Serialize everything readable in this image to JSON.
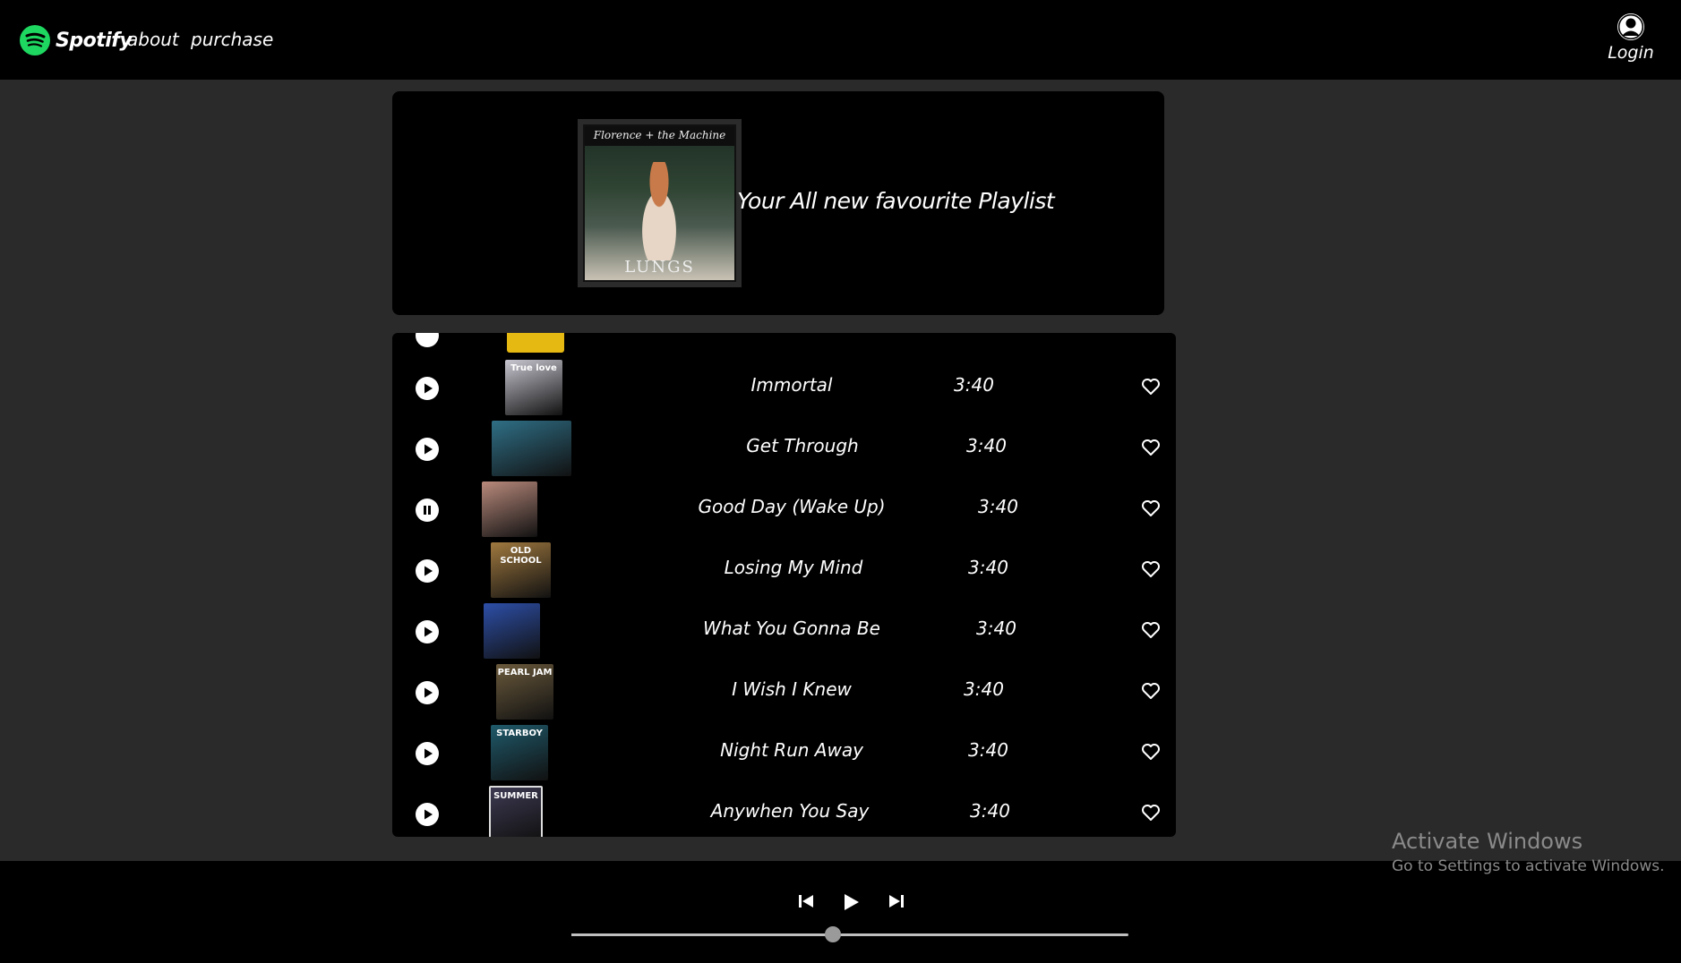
{
  "nav": {
    "brand": "Spotify",
    "links": [
      "about",
      "purchase"
    ],
    "login": "Login",
    "brand_color": "#1ed760"
  },
  "header": {
    "cover_band_text": "Florence + the Machine",
    "cover_title": "LUNGS",
    "title": "Your All new favourite Playlist"
  },
  "tracks": [
    {
      "title": "Immortal",
      "duration": "3:40",
      "state": "play",
      "art": "True love",
      "art_color": "#c8c6d0"
    },
    {
      "title": "Get Through",
      "duration": "3:40",
      "state": "play",
      "art": "",
      "art_color": "#2f6f86"
    },
    {
      "title": "Good Day (Wake Up)",
      "duration": "3:40",
      "state": "pause",
      "art": "",
      "art_color": "#b98a7c"
    },
    {
      "title": "Losing My Mind",
      "duration": "3:40",
      "state": "play",
      "art": "OLD SCHOOL",
      "art_color": "#a0793f"
    },
    {
      "title": "What You Gonna Be",
      "duration": "3:40",
      "state": "play",
      "art": "",
      "art_color": "#2d4fa8"
    },
    {
      "title": "I Wish I Knew",
      "duration": "3:40",
      "state": "play",
      "art": "PEARL JAM",
      "art_color": "#6b5a3c"
    },
    {
      "title": "Night Run Away",
      "duration": "3:40",
      "state": "play",
      "art": "STARBOY",
      "art_color": "#1f5a6b"
    },
    {
      "title": "Anywhen You Say",
      "duration": "3:40",
      "state": "play",
      "art": "SUMMER",
      "art_color": "#3d3a52"
    }
  ],
  "player": {
    "progress": 0.47
  },
  "watermark": {
    "title": "Activate Windows",
    "subtitle": "Go to Settings to activate Windows."
  }
}
